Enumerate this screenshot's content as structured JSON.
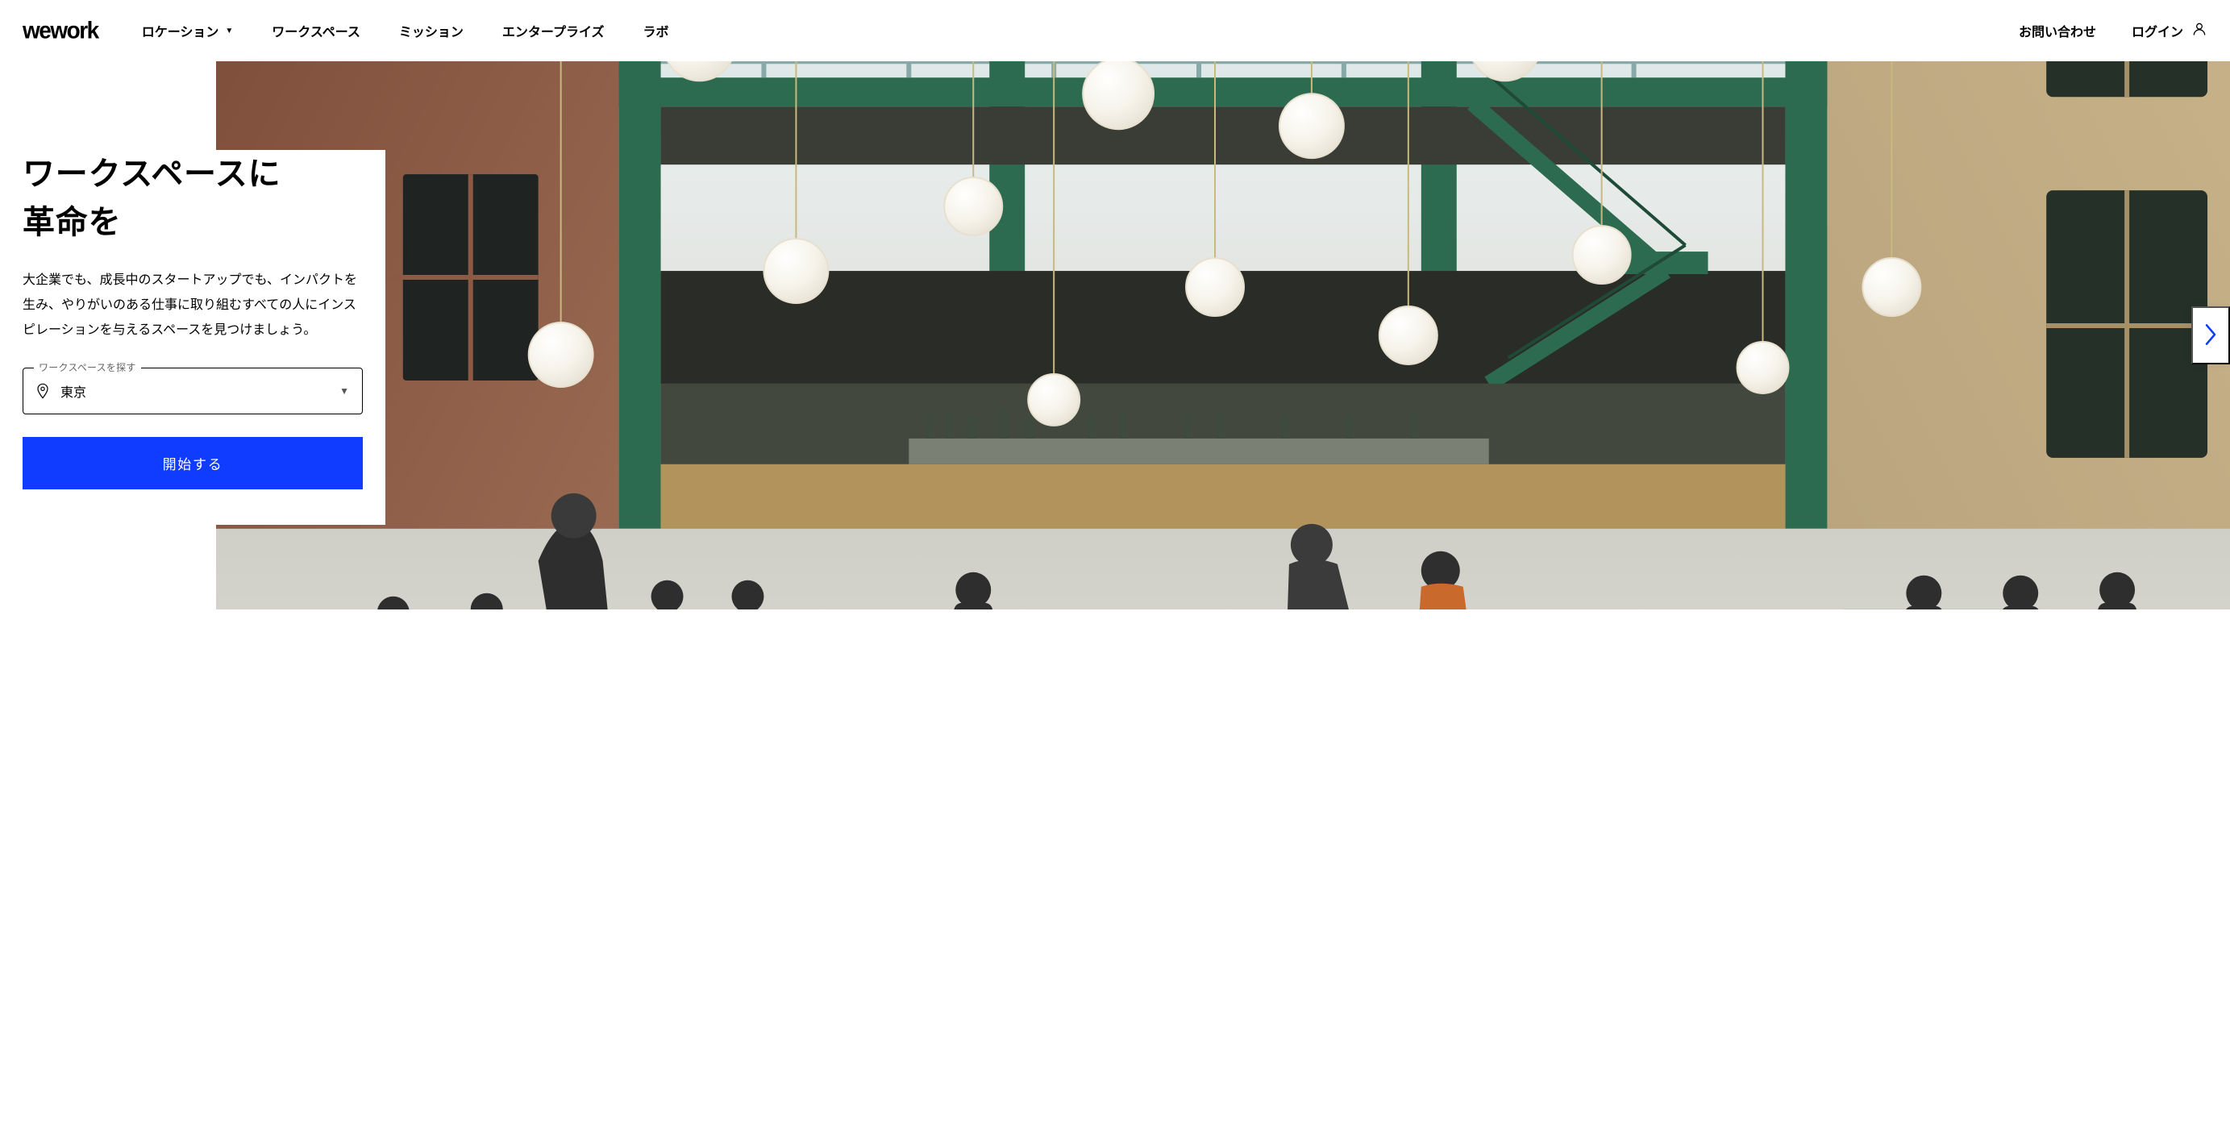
{
  "brand": "wework",
  "nav": {
    "location": "ロケーション",
    "workspace": "ワークスペース",
    "mission": "ミッション",
    "enterprise": "エンタープライズ",
    "labs": "ラボ"
  },
  "right": {
    "contact": "お問い合わせ",
    "login": "ログイン"
  },
  "hero": {
    "title_line1": "ワークスペースに",
    "title_line2": "革命を",
    "subtitle": "大企業でも、成長中のスタートアップでも、インパクトを生み、やりがいのある仕事に取り組むすべての人にインスピレーションを与えるスペースを見つけましょう。",
    "search_label": "ワークスペースを探す",
    "search_value": "東京",
    "cta": "開始する"
  }
}
